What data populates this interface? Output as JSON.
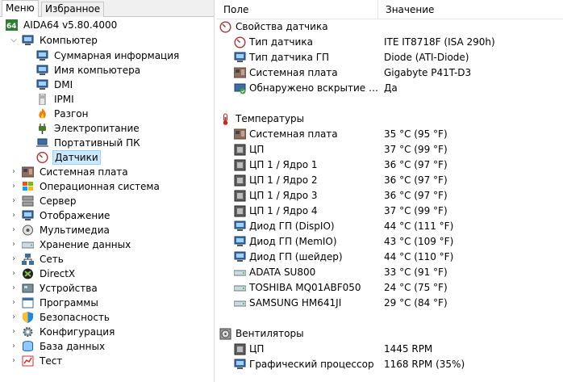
{
  "tabs": {
    "menu": "Меню",
    "favorites": "Избранное"
  },
  "tree": {
    "root": "AIDA64 v5.80.4000",
    "computer": {
      "label": "Компьютер",
      "children": [
        "Суммарная информация",
        "Имя компьютера",
        "DMI",
        "IPMI",
        "Разгон",
        "Электропитание",
        "Портативный ПК",
        "Датчики"
      ]
    },
    "sections": [
      "Системная плата",
      "Операционная система",
      "Сервер",
      "Отображение",
      "Мультимедиа",
      "Хранение данных",
      "Сеть",
      "DirectX",
      "Устройства",
      "Программы",
      "Безопасность",
      "Конфигурация",
      "База данных",
      "Тест"
    ],
    "selected": "Датчики"
  },
  "columns": {
    "field": "Поле",
    "value": "Значение"
  },
  "groups": {
    "sensor": {
      "title": "Свойства датчика",
      "rows": [
        {
          "field": "Тип датчика",
          "value": "ITE IT8718F  (ISA 290h)",
          "icon": "sensor-icon"
        },
        {
          "field": "Тип датчика ГП",
          "value": "Diode  (ATI-Diode)",
          "icon": "monitor-icon"
        },
        {
          "field": "Системная плата",
          "value": "Gigabyte P41T-D3",
          "icon": "motherboard-icon"
        },
        {
          "field": "Обнаружено вскрытие корпуса",
          "value": "Да",
          "icon": "chassis-icon"
        }
      ]
    },
    "temps": {
      "title": "Температуры",
      "rows": [
        {
          "field": "Системная плата",
          "value": "35 °C  (95 °F)",
          "icon": "motherboard-icon"
        },
        {
          "field": "ЦП",
          "value": "37 °C  (99 °F)",
          "icon": "cpu-icon"
        },
        {
          "field": "ЦП 1 / Ядро 1",
          "value": "36 °C  (97 °F)",
          "icon": "cpu-icon"
        },
        {
          "field": "ЦП 1 / Ядро 2",
          "value": "36 °C  (97 °F)",
          "icon": "cpu-icon"
        },
        {
          "field": "ЦП 1 / Ядро 3",
          "value": "36 °C  (97 °F)",
          "icon": "cpu-icon"
        },
        {
          "field": "ЦП 1 / Ядро 4",
          "value": "37 °C  (99 °F)",
          "icon": "cpu-icon"
        },
        {
          "field": "Диод ГП (DispIO)",
          "value": "44 °C  (111 °F)",
          "icon": "monitor-icon"
        },
        {
          "field": "Диод ГП (MemIO)",
          "value": "43 °C  (109 °F)",
          "icon": "monitor-icon"
        },
        {
          "field": "Диод ГП (шейдер)",
          "value": "44 °C  (110 °F)",
          "icon": "monitor-icon"
        },
        {
          "field": "ADATA SU800",
          "value": "33 °C  (91 °F)",
          "icon": "disk-icon"
        },
        {
          "field": "TOSHIBA MQ01ABF050",
          "value": "24 °C  (75 °F)",
          "icon": "disk-icon"
        },
        {
          "field": "SAMSUNG HM641JI",
          "value": "29 °C  (84 °F)",
          "icon": "disk-icon"
        }
      ]
    },
    "fans": {
      "title": "Вентиляторы",
      "rows": [
        {
          "field": "ЦП",
          "value": "1445 RPM",
          "icon": "cpu-icon"
        },
        {
          "field": "Графический процессор",
          "value": "1168 RPM  (35%)",
          "icon": "monitor-icon"
        }
      ]
    }
  }
}
